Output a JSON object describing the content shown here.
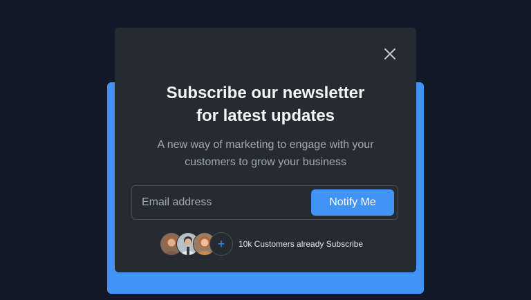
{
  "modal": {
    "title_line1": "Subscribe our newsletter",
    "title_line2": "for latest updates",
    "subtitle_line1": "A new way of marketing to engage with your",
    "subtitle_line2": "customers to grow your business",
    "close_icon": "close-icon"
  },
  "form": {
    "email_placeholder": "Email address",
    "email_value": "",
    "submit_label": "Notify Me"
  },
  "social_proof": {
    "more_symbol": "+",
    "text": "10k Customers already Subscribe",
    "avatars": [
      "avatar-woman-1",
      "avatar-man",
      "avatar-woman-2"
    ]
  },
  "colors": {
    "page_background": "#121827",
    "modal_background": "#262b32",
    "accent": "#4194f6",
    "text_primary": "#f3f4f6",
    "text_secondary": "#a3a9b3"
  }
}
